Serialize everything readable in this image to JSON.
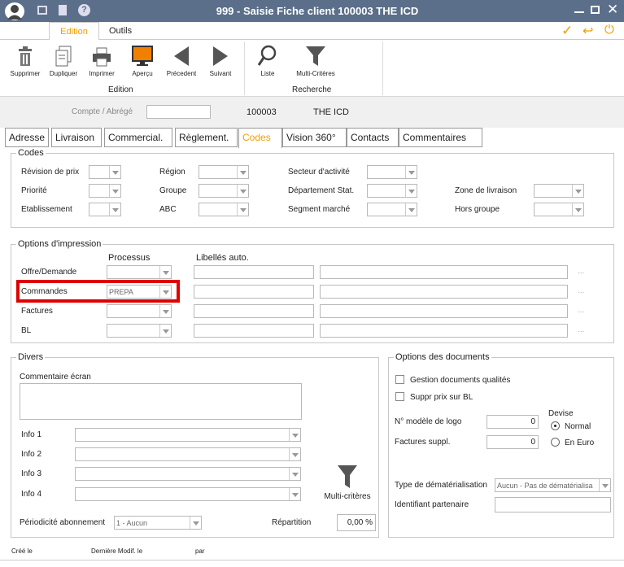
{
  "window": {
    "title": "999 - Saisie Fiche client 100003 THE ICD"
  },
  "menu": {
    "edition": "Edition",
    "outils": "Outils"
  },
  "ribbon": {
    "supprimer": "Supprimer",
    "dupliquer": "Dupliquer",
    "imprimer": "Imprimer",
    "apercu": "Aperçu",
    "precedent": "Précedent",
    "suivant": "Suivant",
    "liste": "Liste",
    "multi": "Multi-Critères",
    "group_edition": "Edition",
    "group_recherche": "Recherche"
  },
  "header": {
    "compte_label": "Compte / Abrégé",
    "compte_value": "",
    "code": "100003",
    "name": "THE ICD"
  },
  "tabs": [
    "Adresse",
    "Livraison",
    "Commercial.",
    "Règlement.",
    "Codes",
    "Vision 360°",
    "Contacts",
    "Commentaires"
  ],
  "codes": {
    "title": "Codes",
    "revision": "Révision de prix",
    "region": "Région",
    "secteur": "Secteur d'activité",
    "priorite": "Priorité",
    "groupe": "Groupe",
    "departement": "Département Stat.",
    "zone": "Zone de livraison",
    "etablissement": "Etablissement",
    "abc": "ABC",
    "segment": "Segment marché",
    "hors": "Hors groupe"
  },
  "impression": {
    "title": "Options d'impression",
    "processus": "Processus",
    "libelles": "Libellés auto.",
    "offre": "Offre/Demande",
    "commandes": "Commandes",
    "commandes_value": "PREPA",
    "factures": "Factures",
    "bl": "BL",
    "dots": "..."
  },
  "divers": {
    "title": "Divers",
    "commentaire": "Commentaire écran",
    "info1": "Info 1",
    "info2": "Info 2",
    "info3": "Info 3",
    "info4": "Info 4",
    "multi": "Multi-critères",
    "periodicite": "Périodicité abonnement",
    "periodicite_value": "1 - Aucun",
    "repartition": "Répartition",
    "repartition_value": "0,00 %"
  },
  "options": {
    "title": "Options des documents",
    "gestion": "Gestion documents qualités",
    "suppr": "Suppr prix sur BL",
    "modele": "N° modèle de logo",
    "modele_value": "0",
    "factures": "Factures suppl.",
    "factures_value": "0",
    "devise": "Devise",
    "normal": "Normal",
    "euro": "En Euro",
    "type": "Type de dématérialisation",
    "type_value": "Aucun - Pas de dématérialisa",
    "identifiant": "Identifiant partenaire"
  },
  "footer": {
    "cree": "Créé le",
    "modif": "Dernière Modif. le",
    "par": "par"
  },
  "colors": {
    "titlebar": "#5b6f8a",
    "accent": "#f0a000",
    "highlight": "#e00000"
  }
}
